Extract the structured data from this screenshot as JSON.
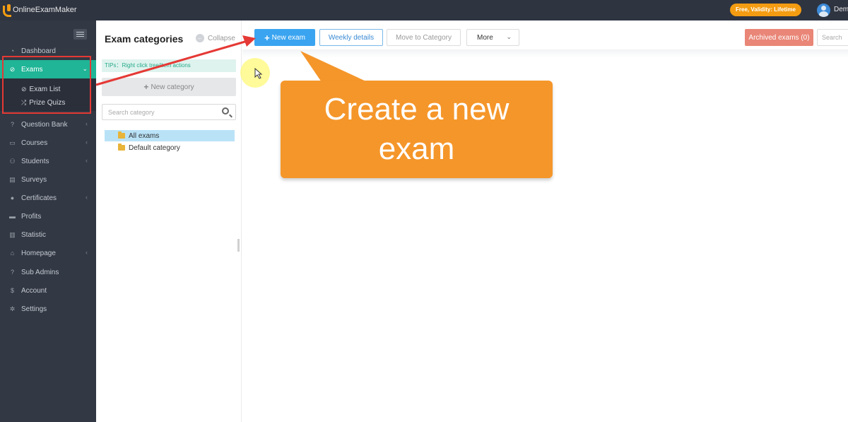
{
  "app": {
    "logo_text": "OnlineExamMaker",
    "validity_badge": "Free, Validity: Lifetime",
    "username": "Demo"
  },
  "sidebar": {
    "items": [
      {
        "label": "Dashboard",
        "icon": "dashboard-icon"
      },
      {
        "label": "Exams",
        "icon": "check-circle-icon",
        "active": true
      },
      {
        "label": "Question Bank",
        "icon": "question-icon"
      },
      {
        "label": "Courses",
        "icon": "courses-icon"
      },
      {
        "label": "Students",
        "icon": "students-icon"
      },
      {
        "label": "Surveys",
        "icon": "surveys-icon"
      },
      {
        "label": "Certificates",
        "icon": "certificate-icon"
      },
      {
        "label": "Profits",
        "icon": "profits-icon"
      },
      {
        "label": "Statistic",
        "icon": "statistic-icon"
      },
      {
        "label": "Homepage",
        "icon": "homepage-icon"
      },
      {
        "label": "Sub Admins",
        "icon": "sub-admins-icon"
      },
      {
        "label": "Account",
        "icon": "dollar-icon"
      },
      {
        "label": "Settings",
        "icon": "gear-icon"
      }
    ],
    "exams_submenu": [
      {
        "label": "Exam List",
        "icon": "check-circle-icon"
      },
      {
        "label": "Prize Quizs",
        "icon": "shuffle-icon"
      }
    ]
  },
  "categories": {
    "title": "Exam categories",
    "collapse_label": "Collapse",
    "tips": "TIPs：Right click tree/item actions",
    "new_category_label": "New category",
    "search_placeholder": "Search category",
    "tree": [
      {
        "label": "All exams",
        "selected": true
      },
      {
        "label": "Default category",
        "selected": false
      }
    ]
  },
  "toolbar": {
    "new_exam": "New exam",
    "weekly_details": "Weekly details",
    "move_to_category": "Move to Category",
    "more": "More",
    "archived": "Archived exams (0)",
    "search_placeholder": "Search"
  },
  "annotation": {
    "callout_text": "Create a new exam",
    "colors": {
      "callout": "#f5962a",
      "highlight": "#e53935",
      "accent": "#1fb596"
    }
  }
}
